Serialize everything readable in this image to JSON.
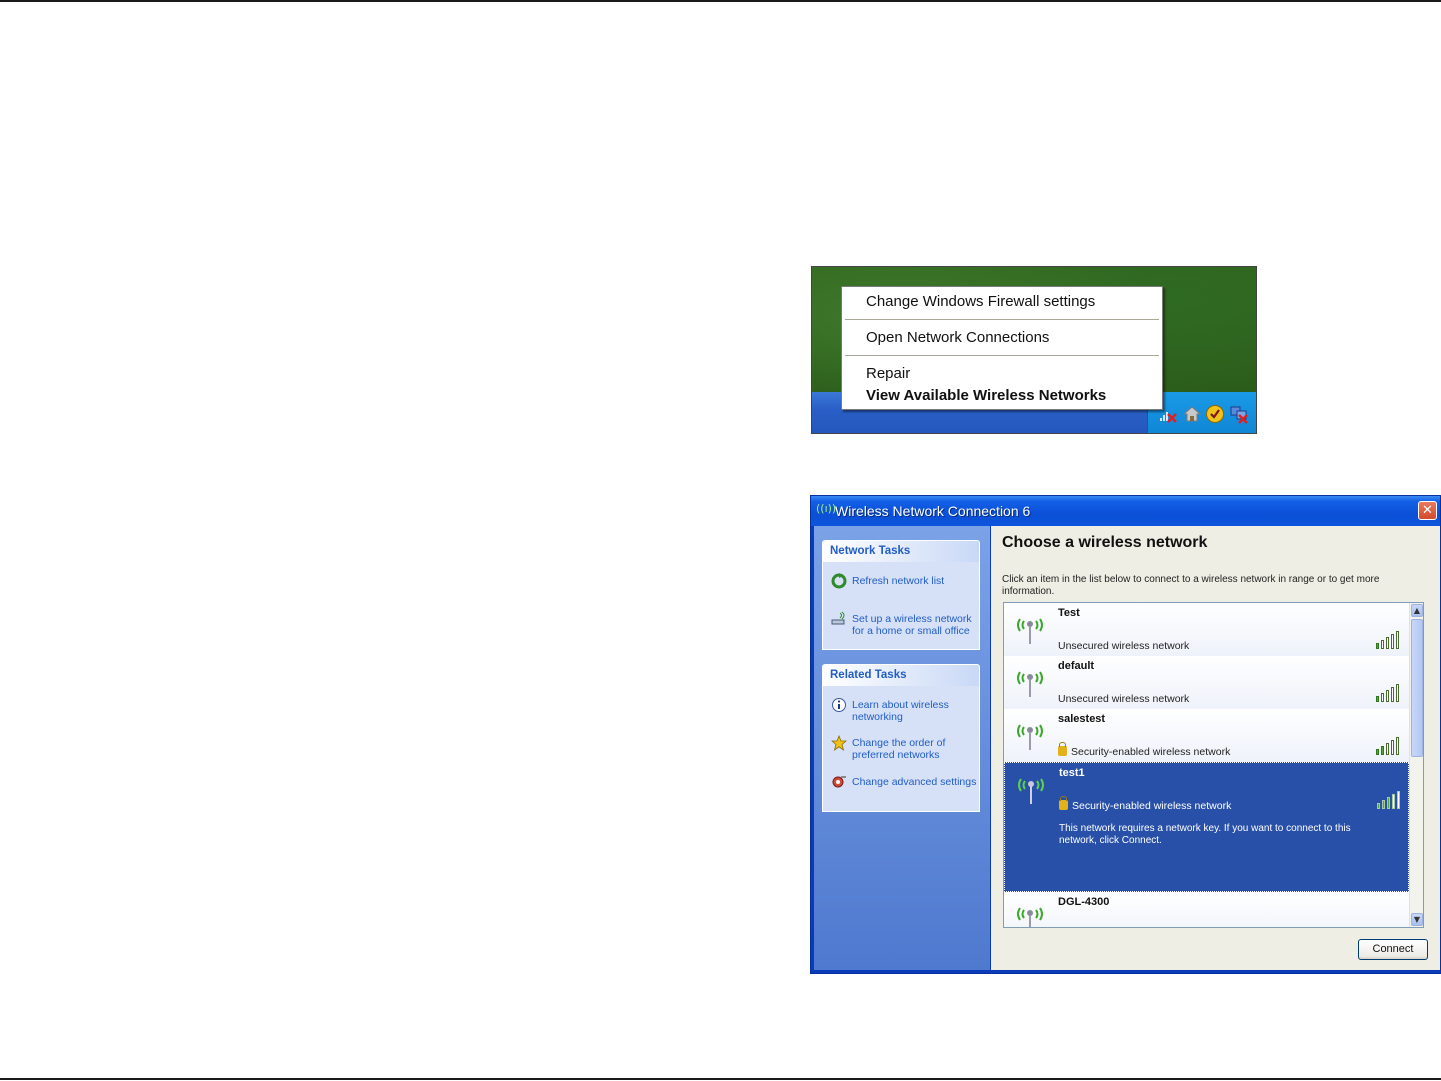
{
  "context_menu": {
    "items": [
      {
        "label": "Change Windows Firewall settings"
      },
      {
        "label": "Open Network Connections"
      },
      {
        "label": "Repair"
      },
      {
        "label": "View Available Wireless Networks",
        "bold": true
      }
    ],
    "tray_icons": [
      "wireless-disconnected-icon",
      "home-network-icon",
      "security-center-icon",
      "network-disconnected-icon"
    ]
  },
  "dialog": {
    "title": "Wireless Network Connection 6",
    "close_label": "✕",
    "network_tasks": {
      "heading": "Network Tasks",
      "items": [
        {
          "label": "Refresh network list",
          "icon": "refresh-icon"
        },
        {
          "label": "Set up a wireless network for a home or small office",
          "icon": "setup-network-icon"
        }
      ]
    },
    "related_tasks": {
      "heading": "Related Tasks",
      "items": [
        {
          "label": "Learn about wireless networking",
          "icon": "info-icon"
        },
        {
          "label": "Change the order of preferred networks",
          "icon": "star-icon"
        },
        {
          "label": "Change advanced settings",
          "icon": "settings-icon"
        }
      ]
    },
    "heading": "Choose a wireless network",
    "description": "Click an item in the list below to connect to a wireless network in range or to get more information.",
    "networks": [
      {
        "name": "Test",
        "status": "Unsecured wireless network",
        "secured": false,
        "signal": 1
      },
      {
        "name": "default",
        "status": "Unsecured wireless network",
        "secured": false,
        "signal": 1
      },
      {
        "name": "salestest",
        "status": "Security-enabled wireless network",
        "secured": true,
        "signal": 2
      },
      {
        "name": "test1",
        "status": "Security-enabled wireless network",
        "secured": true,
        "signal": 3,
        "selected": true,
        "message": "This network requires a network key. If you want to connect to this network, click Connect."
      },
      {
        "name": "DGL-4300",
        "status": "",
        "secured": false,
        "signal": 1
      }
    ],
    "connect_label": "Connect"
  }
}
